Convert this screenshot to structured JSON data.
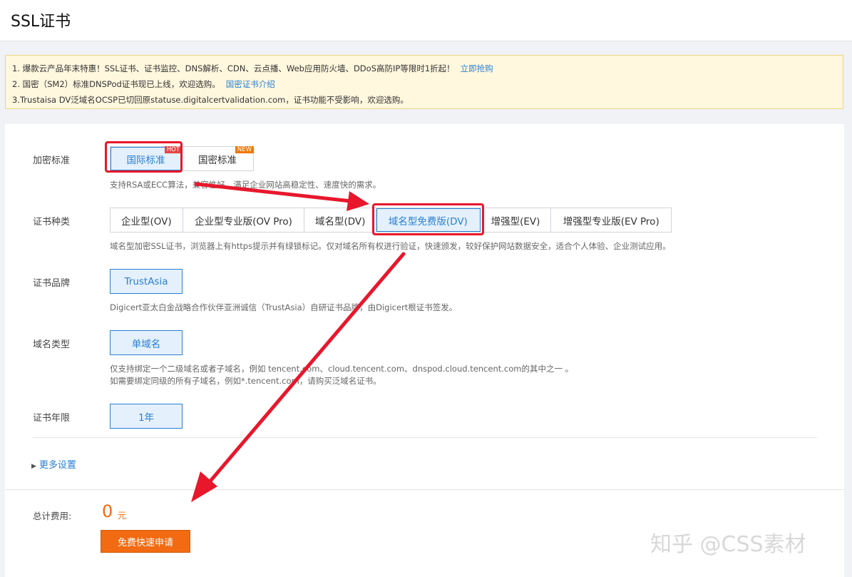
{
  "title": "SSL证书",
  "notices": [
    {
      "text": "1. 爆款云产品年末特惠！SSL证书、证书监控、DNS解析、CDN、云点播、Web应用防火墙、DDoS高防IP等限时1折起！",
      "link": "立即抢购"
    },
    {
      "text": "2. 国密（SM2）标准DNSPod证书现已上线，欢迎选购。",
      "link": "国密证书介绍"
    },
    {
      "text": "3.Trustaisa DV泛域名OCSP已切回原statuse.digitalcertvalidation.com，证书功能不受影响，欢迎选购。",
      "link": ""
    }
  ],
  "encryption": {
    "label": "加密标准",
    "options": [
      "国际标准",
      "国密标准"
    ],
    "badges": [
      "HOT",
      "NEW"
    ],
    "selected": "国际标准",
    "desc": "支持RSA或ECC算法，兼容性好，满足企业网站高稳定性、速度快的需求。"
  },
  "cert_type": {
    "label": "证书种类",
    "options": [
      "企业型(OV)",
      "企业型专业版(OV Pro)",
      "域名型(DV)",
      "域名型免费版(DV)",
      "增强型(EV)",
      "增强型专业版(EV Pro)"
    ],
    "selected": "域名型免费版(DV)",
    "desc": "域名型加密SSL证书，浏览器上有https提示并有绿锁标记。仅对域名所有权进行验证，快速颁发，较好保护网站数据安全，适合个人体验、企业测试应用。"
  },
  "brand": {
    "label": "证书品牌",
    "value": "TrustAsia",
    "desc": "Digicert亚太白金战略合作伙伴亚洲诚信（TrustAsia）自研证书品牌，由Digicert根证书签发。"
  },
  "domain_type": {
    "label": "域名类型",
    "value": "单域名",
    "desc1": "仅支持绑定一个二级域名或者子域名，例如 tencent.com、cloud.tencent.com、dnspod.cloud.tencent.com的其中之一 。",
    "desc2": "如需要绑定同级的所有子域名，例如*.tencent.com，请购买泛域名证书。"
  },
  "term": {
    "label": "证书年限",
    "value": "1年"
  },
  "more_settings": "更多设置",
  "total": {
    "label": "总计费用:",
    "value": "0",
    "unit": "元"
  },
  "apply_button": "免费快速申请",
  "watermark": "知乎 @CSS素材",
  "colors": {
    "accent": "#2a80d3",
    "orange": "#f26b12",
    "annotation_red": "#e8172c"
  }
}
